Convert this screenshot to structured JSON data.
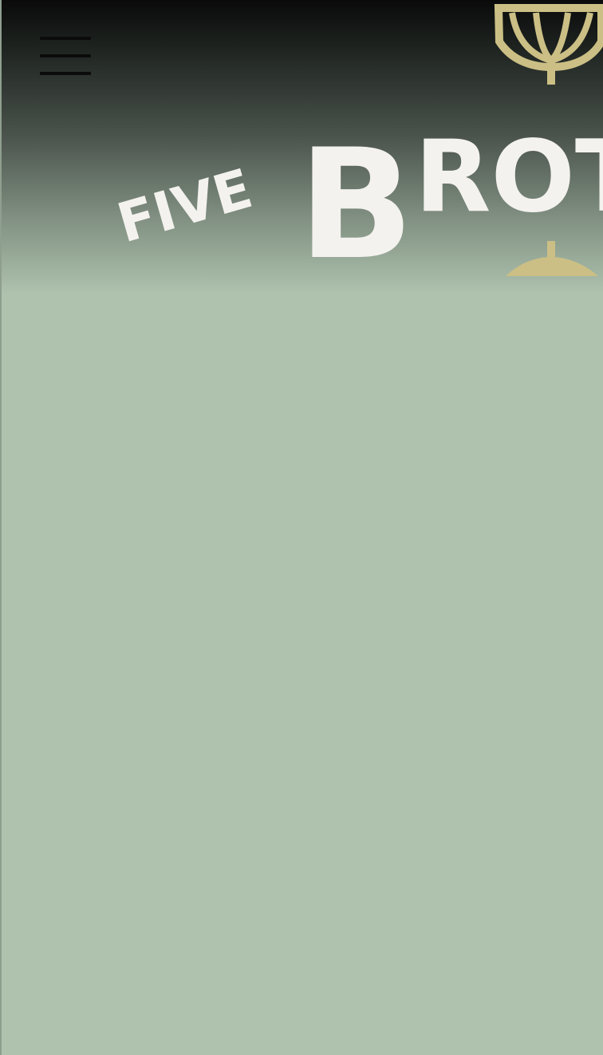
{
  "header": {
    "menu_icon": "hamburger-menu-icon",
    "logo": {
      "word_five": "FIVE",
      "letter_b": "B",
      "word_rest": "ROTH",
      "emblem_icon": "goblet-icon",
      "colors": {
        "text": "#f4f2ee",
        "emblem": "#cbbf85"
      }
    }
  },
  "page": {
    "background_color": "#aec2ae"
  }
}
